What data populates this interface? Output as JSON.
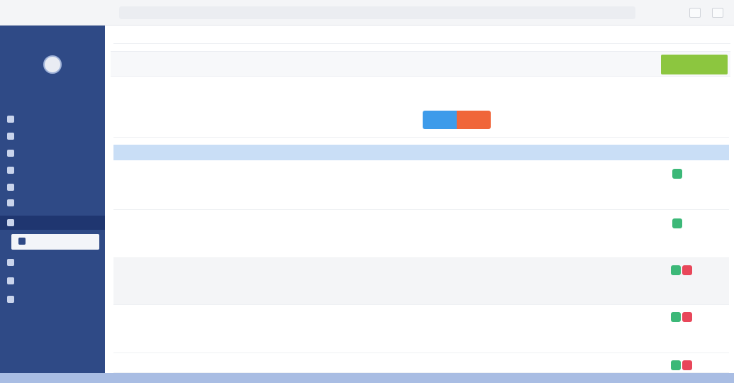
{
  "window": {
    "url": ""
  },
  "sidebar": {
    "brand": "",
    "user_name": "",
    "items": [
      {
        "label": ""
      },
      {
        "label": ""
      },
      {
        "label": ""
      },
      {
        "label": ""
      },
      {
        "label": ""
      },
      {
        "label": ""
      },
      {
        "label": ""
      },
      {
        "label": ""
      },
      {
        "label": ""
      },
      {
        "label": ""
      },
      {
        "label": ""
      }
    ]
  },
  "breadcrumb": {
    "text": ""
  },
  "page": {
    "title": "",
    "add_button": ""
  },
  "filter": {
    "label": "",
    "hint": "",
    "toggle_left": "",
    "toggle_right": ""
  },
  "table": {
    "columns": [
      "",
      "",
      "",
      "",
      "",
      ""
    ],
    "rows": [
      {
        "id": "",
        "name": "",
        "count": "",
        "info": [
          "",
          ""
        ],
        "detail": [
          "",
          ""
        ]
      },
      {
        "id": "",
        "name": "",
        "count": "",
        "info": [
          "",
          ""
        ],
        "detail": [
          "",
          ""
        ]
      },
      {
        "id": "",
        "name": "",
        "count": "",
        "info": [
          "",
          ""
        ],
        "detail": [
          "",
          ""
        ]
      },
      {
        "id": "",
        "name": "",
        "count": "",
        "info": [
          "",
          ""
        ],
        "detail": [
          "",
          ""
        ]
      },
      {
        "id": "",
        "name": "",
        "count": "",
        "info": [
          "",
          ""
        ],
        "detail": [
          "",
          ""
        ]
      }
    ]
  },
  "colors": {
    "sidebar": "#2f4a86",
    "table_header": "#c9def6",
    "add_button": "#8cc63f",
    "toggle_left": "#3d9bea",
    "toggle_right": "#f0663a",
    "action_green": "#3cb878",
    "action_red": "#e8475a"
  }
}
